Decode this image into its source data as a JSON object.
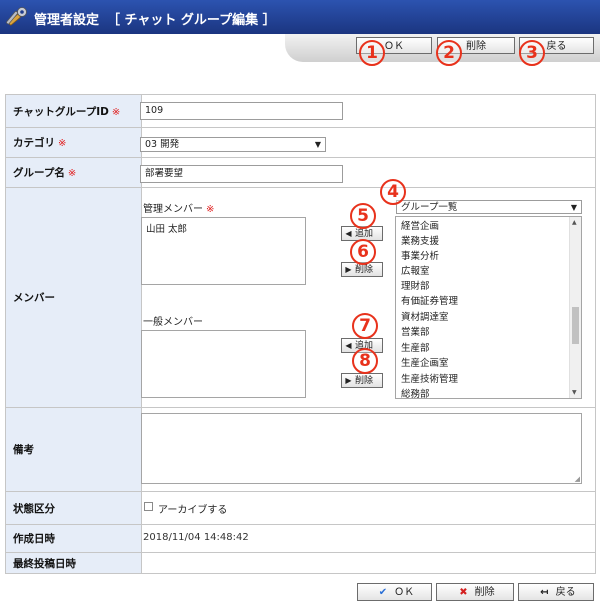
{
  "header": {
    "title": "管理者設定",
    "subtitle": "［ チャット グループ編集 ］",
    "icon": "tools-icon"
  },
  "toolbar": {
    "ok_label": "ＯＫ",
    "delete_label": "削除",
    "back_label": "戻る"
  },
  "callouts": [
    "1",
    "2",
    "3",
    "4",
    "5",
    "6",
    "7",
    "8"
  ],
  "form": {
    "required_mark": "※",
    "group_id": {
      "label": "チャットグループID",
      "value": "109"
    },
    "category": {
      "label": "カテゴリ",
      "value": "03  開発"
    },
    "group_name": {
      "label": "グループ名",
      "value": "部署要望"
    },
    "members": {
      "label": "メンバー",
      "admin_label": "管理メンバー",
      "admin_members": [
        "山田 太郎"
      ],
      "general_label": "一般メンバー",
      "general_members": [],
      "add_label": "追加",
      "remove_label": "削除",
      "group_select": "グループ一覧",
      "group_list": [
        "経営企画",
        "業務支援",
        "事業分析",
        "広報室",
        "理財部",
        "有価証券管理",
        "資材調達室",
        "営業部",
        "生産部",
        "生産企画室",
        "生産技術管理",
        "総務部"
      ]
    },
    "notes": {
      "label": "備考",
      "value": ""
    },
    "status": {
      "label": "状態区分",
      "archive_label": "アーカイブする",
      "archived": false
    },
    "created": {
      "label": "作成日時",
      "value": "2018/11/04 14:48:42"
    },
    "last_post": {
      "label": "最終投稿日時",
      "value": ""
    }
  },
  "colors": {
    "header_bg": "#1f3c8c",
    "label_bg": "#e6edf8",
    "required": "#e02020",
    "callout": "#e8321c",
    "ok_check": "#2a6fd6",
    "delete_x": "#d42020"
  }
}
